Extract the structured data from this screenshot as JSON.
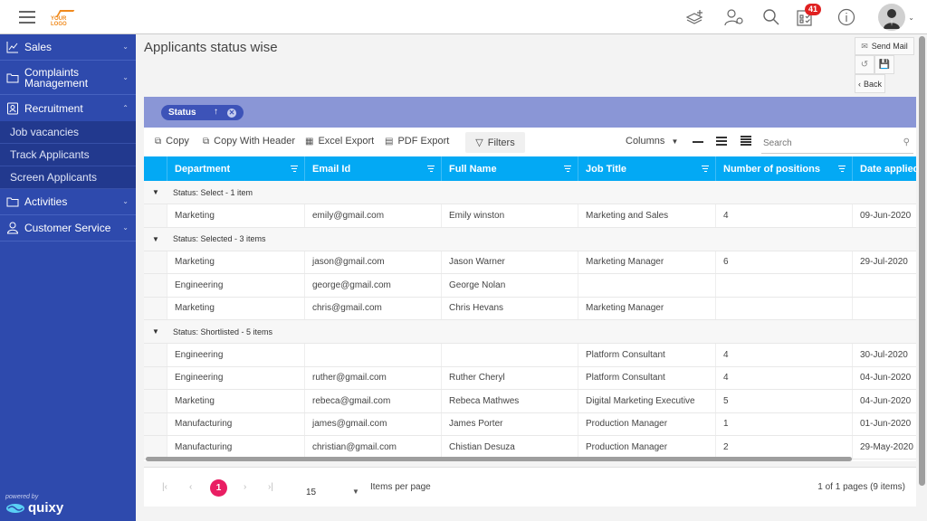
{
  "header": {
    "logo_text": "YOUR LOGO",
    "notification_count": "41",
    "icons": [
      "add-layers-icon",
      "user-settings-icon",
      "search-icon",
      "tasks-icon",
      "info-icon",
      "avatar-icon"
    ]
  },
  "sidebar": {
    "items": [
      {
        "label": "Sales",
        "icon": "chart-icon",
        "expanded": false
      },
      {
        "label": "Complaints Management",
        "icon": "folder-icon",
        "expanded": false
      },
      {
        "label": "Recruitment",
        "icon": "contact-card-icon",
        "expanded": true,
        "children": [
          "Job vacancies",
          "Track Applicants",
          "Screen Applicants"
        ]
      },
      {
        "label": "Activities",
        "icon": "folder-icon",
        "expanded": false
      },
      {
        "label": "Customer Service",
        "icon": "user-icon",
        "expanded": false
      }
    ],
    "footer": {
      "powered_by": "powered by",
      "brand": "quixy"
    }
  },
  "page": {
    "title": "Applicants status wise",
    "actions": {
      "send_mail": "Send Mail",
      "back": "Back"
    }
  },
  "grouping": {
    "chip_label": "Status",
    "sort": "ascending"
  },
  "toolbar": {
    "copy": "Copy",
    "copy_with_header": "Copy With Header",
    "excel_export": "Excel Export",
    "pdf_export": "PDF Export",
    "filters": "Filters",
    "columns": "Columns",
    "search_placeholder": "Search"
  },
  "grid": {
    "columns": [
      "Department",
      "Email Id",
      "Full Name",
      "Job Title",
      "Number of positions",
      "Date applied"
    ],
    "groups": [
      {
        "label": "Status: Select - 1 item",
        "rows": [
          [
            "Marketing",
            "emily@gmail.com",
            "Emily winston",
            "Marketing and Sales",
            "4",
            "09-Jun-2020"
          ]
        ]
      },
      {
        "label": "Status: Selected - 3 items",
        "rows": [
          [
            "Marketing",
            "jason@gmail.com",
            "Jason Warner",
            "Marketing Manager",
            "6",
            "29-Jul-2020"
          ],
          [
            "Engineering",
            "george@gmail.com",
            "George Nolan",
            "",
            "",
            ""
          ],
          [
            "Marketing",
            "chris@gmail.com",
            "Chris Hevans",
            "Marketing Manager",
            "",
            ""
          ]
        ]
      },
      {
        "label": "Status: Shortlisted - 5 items",
        "rows": [
          [
            "Engineering",
            "",
            "",
            "Platform Consultant",
            "4",
            "30-Jul-2020"
          ],
          [
            "Engineering",
            "ruther@gmail.com",
            "Ruther Cheryl",
            "Platform Consultant",
            "4",
            "04-Jun-2020"
          ],
          [
            "Marketing",
            "rebeca@gmail.com",
            "Rebeca Mathwes",
            "Digital Marketing Executive",
            "5",
            "04-Jun-2020"
          ],
          [
            "Manufacturing",
            "james@gmail.com",
            "James Porter",
            "Production Manager",
            "1",
            "01-Jun-2020"
          ],
          [
            "Manufacturing",
            "christian@gmail.com",
            "Chistian Desuza",
            "Production Manager",
            "2",
            "29-May-2020"
          ]
        ]
      }
    ]
  },
  "pager": {
    "current_page": "1",
    "page_size": "15",
    "page_size_label": "Items per page",
    "info": "1 of 1 pages (9 items)"
  },
  "colors": {
    "sidebar": "#2e4aad",
    "header_row": "#03a9f4",
    "group_bar": "#8a96d6",
    "active_page": "#e91e63",
    "badge": "#e02020"
  }
}
